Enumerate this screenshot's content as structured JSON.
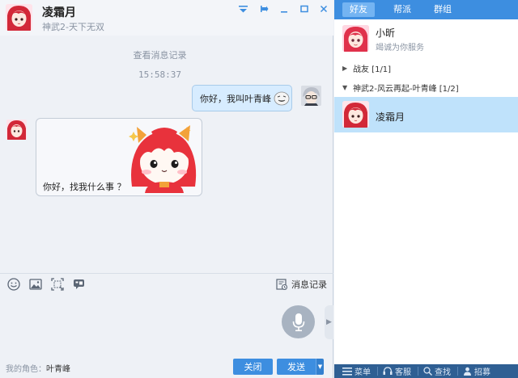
{
  "chat": {
    "contact_name": "凌霜月",
    "contact_subtitle": "神武2-天下无双",
    "history_link": "查看消息记录",
    "timestamp": "15:58:37",
    "messages": [
      {
        "from": "me",
        "text": "你好，我叫叶青峰"
      },
      {
        "from": "friend",
        "text": "你好，找我什么事 ？"
      }
    ],
    "toolbar": {
      "history_label": "消息记录"
    },
    "role_label": "我的角色：",
    "role_value": "叶青峰",
    "close_label": "关闭",
    "send_label": "发送"
  },
  "panel": {
    "tabs": [
      {
        "label": "好友",
        "active": true
      },
      {
        "label": "帮派",
        "active": false
      },
      {
        "label": "群组",
        "active": false
      }
    ],
    "assistant": {
      "name": "小昕",
      "desc": "竭诚为你服务"
    },
    "groups": [
      {
        "label": "战友 [1/1]",
        "expanded": false
      },
      {
        "label": "神武2-风云再起-叶青峰 [1/2]",
        "expanded": true
      }
    ],
    "selected_friend": "凌霜月",
    "footer": [
      {
        "label": "菜单",
        "icon": "menu-icon"
      },
      {
        "label": "客服",
        "icon": "headset-icon"
      },
      {
        "label": "查找",
        "icon": "search-icon"
      },
      {
        "label": "招募",
        "icon": "user-add-icon"
      }
    ]
  },
  "colors": {
    "accent": "#3d8ee0",
    "selected_row": "#bfe2fb",
    "chat_bg": "#eef1f6",
    "out_bubble": "#d7ecff"
  }
}
